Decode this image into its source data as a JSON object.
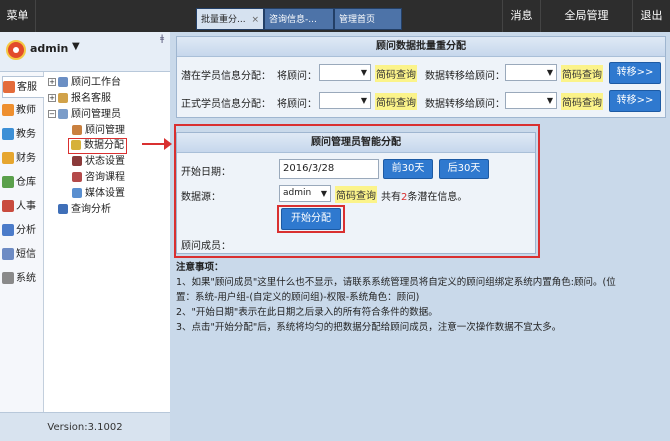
{
  "topbar": {
    "menu_label": "菜单",
    "tabs": [
      {
        "label": "批量重分...",
        "close": "×"
      },
      {
        "label": "咨询信息-...",
        "close": ""
      },
      {
        "label": "管理首页",
        "close": ""
      }
    ],
    "message_label": "消息",
    "global_label": "全局管理",
    "logout_label": "退出"
  },
  "user": {
    "name": "admin",
    "dropdown": "▼",
    "pin": "ǂ"
  },
  "nav": [
    {
      "label": "客服",
      "color": "#e46b3a"
    },
    {
      "label": "教师",
      "color": "#ee8f2f"
    },
    {
      "label": "教务",
      "color": "#3c8fd6"
    },
    {
      "label": "财务",
      "color": "#e6a62f"
    },
    {
      "label": "仓库",
      "color": "#5aa04b"
    },
    {
      "label": "人事",
      "color": "#c94b3e"
    },
    {
      "label": "分析",
      "color": "#4b7bc9"
    },
    {
      "label": "短信",
      "color": "#6d8bc4"
    },
    {
      "label": "系统",
      "color": "#8a8a8a"
    }
  ],
  "tree": {
    "workbench": "顾问工作台",
    "enroll": "报名客服",
    "admin": "顾问管理员",
    "manage": "顾问管理",
    "distribute": "数据分配",
    "status": "状态设置",
    "course": "咨询课程",
    "media": "媒体设置",
    "analysis": "查询分析",
    "plus": "+",
    "minus": "−"
  },
  "version": "Version:3.1002",
  "batch": {
    "title": "顾问数据批量重分配",
    "row1_label": "潜在学员信息分配：",
    "row2_label": "正式学员信息分配：",
    "from_label": "将顾问：",
    "query": "简码查询",
    "to_label": "数据转移给顾问：",
    "transfer": "转移>>",
    "caret": "▼"
  },
  "smart": {
    "title": "顾问管理员智能分配",
    "start_label": "开始日期：",
    "start_value": "2016/3/28",
    "prev30": "前30天",
    "next30": "后30天",
    "source_label": "数据源：",
    "source_value": "admin",
    "caret": "▼",
    "query": "简码查询",
    "info_pre": "共有",
    "info_count": "2",
    "info_post": "条潜在信息。",
    "start_button": "开始分配",
    "members_label": "顾问成员："
  },
  "notes": {
    "title": "注意事项：",
    "line1": "1、如果\"顾问成员\"这里什么也不显示，请联系系统管理员将自定义的顾问组绑定系统内置角色:顾问。(位",
    "line1b": "置：系统-用户组-(自定义的顾问组)-权限-系统角色：顾问)",
    "line2": "2、\"开始日期\"表示在此日期之后录入的所有符合条件的数据。",
    "line3": "3、点击\"开始分配\"后，系统将均匀的把数据分配给顾问成员，注意一次操作数据不宜太多。"
  }
}
